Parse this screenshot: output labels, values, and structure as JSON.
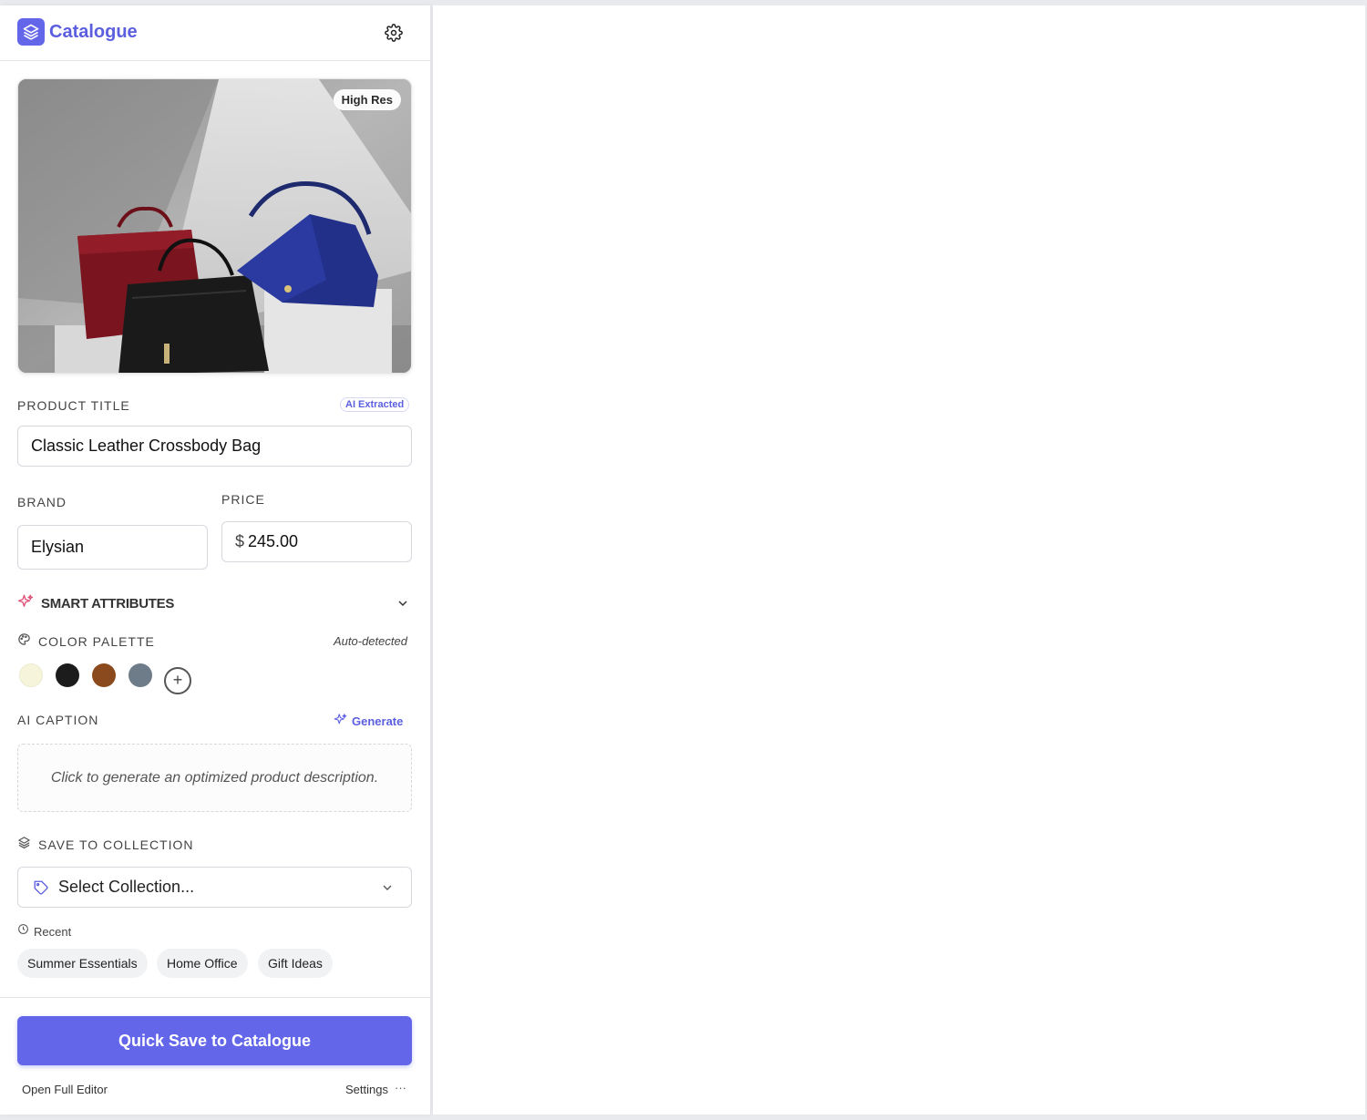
{
  "header": {
    "app_title": "Catalogue",
    "logo_icon": "layers-icon",
    "settings_icon": "gear-icon"
  },
  "image": {
    "badge": "High Res"
  },
  "product_title": {
    "label": "PRODUCT TITLE",
    "badge": "AI Extracted",
    "value": "Classic Leather Crossbody Bag"
  },
  "brand": {
    "label": "BRAND",
    "value": "Elysian"
  },
  "price": {
    "label": "PRICE",
    "currency": "$",
    "value": "245.00"
  },
  "smart_attributes": {
    "label": "SMART ATTRIBUTES",
    "icon": "sparkle-icon",
    "expanded": true
  },
  "color_palette": {
    "label": "COLOR PALETTE",
    "status": "Auto-detected",
    "swatches": [
      "#f6f5dc",
      "#1c1c1c",
      "#8b4a1e",
      "#6e7b88"
    ],
    "add_label": "+"
  },
  "ai_caption": {
    "label": "AI CAPTION",
    "generate_label": "Generate",
    "placeholder": "Click to generate an optimized product description."
  },
  "collection": {
    "label": "SAVE TO COLLECTION",
    "select_placeholder": "Select Collection...",
    "recent_label": "Recent",
    "recent": [
      "Summer Essentials",
      "Home Office",
      "Gift Ideas"
    ]
  },
  "footer": {
    "primary_button": "Quick Save to Catalogue",
    "open_editor": "Open Full Editor",
    "settings": "Settings",
    "more": "···"
  },
  "colors": {
    "accent": "#6366e9",
    "accent_text": "#5b5fdf",
    "sparkle": "#e0527a"
  }
}
